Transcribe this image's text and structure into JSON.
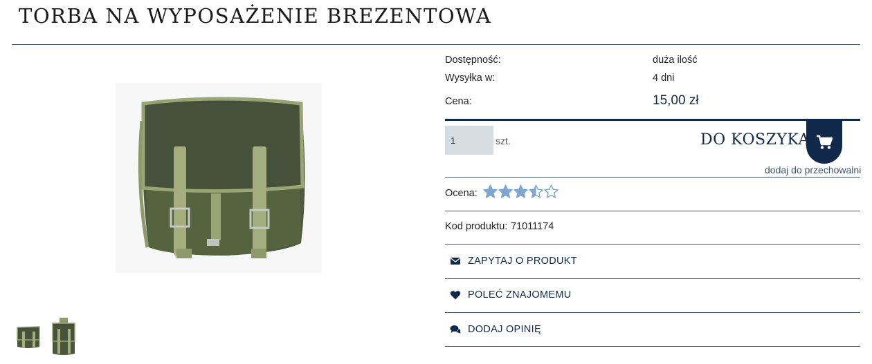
{
  "product": {
    "title": "TORBA NA WYPOSAŻENIE BREZENTOWA",
    "availability_label": "Dostępność:",
    "availability_value": "duża ilość",
    "shipping_label": "Wysyłka w:",
    "shipping_value": "4 dni",
    "price_label": "Cena:",
    "price_value": "15,00 zł",
    "code_label": "Kod produktu:",
    "code_value": "71011174"
  },
  "cart": {
    "quantity_value": "1",
    "unit_label": "szt.",
    "add_to_cart_label": "DO KOSZYKA",
    "storage_link": "dodaj do przechowalni"
  },
  "rating": {
    "label": "Ocena:",
    "value": 3.5,
    "max": 5
  },
  "actions": {
    "ask_label": "ZAPYTAJ O PRODUKT",
    "recommend_label": "POLEĆ ZNAJOMEMU",
    "review_label": "DODAJ OPINIĘ"
  },
  "icons": {
    "cart": "cart-icon",
    "envelope": "envelope-icon",
    "heart": "heart-icon",
    "comments": "comments-icon",
    "star": "star-icon"
  },
  "colors": {
    "accent_navy": "#10284a",
    "rule": "#3d5266",
    "star_fill": "#7fa6cf",
    "qty_bg": "#d5dde3"
  }
}
